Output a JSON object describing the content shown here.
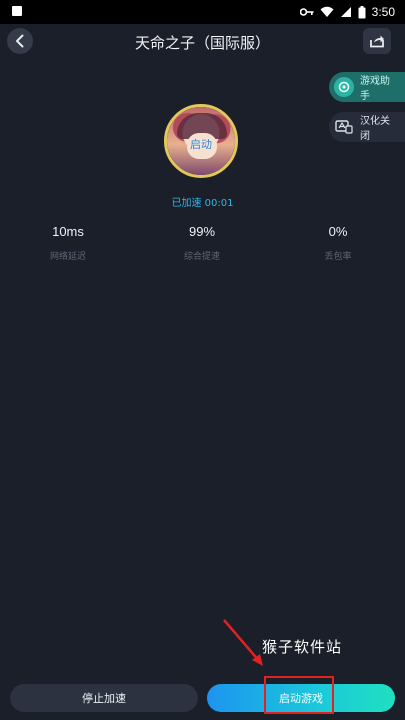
{
  "status_bar": {
    "time": "3:50",
    "icons": [
      "key-icon",
      "wifi-icon",
      "signal-icon",
      "battery-icon"
    ]
  },
  "header": {
    "title": "天命之子（国际服）",
    "back_icon": "chevron-left-icon",
    "share_icon": "share-icon"
  },
  "side_pills": {
    "assistant_label": "游戏助手",
    "chinese_label": "汉化关闭"
  },
  "avatar": {
    "overlay_text": "启动"
  },
  "accel": {
    "status": "已加速 00:01"
  },
  "stats": [
    {
      "value": "10ms",
      "label": "网络延迟"
    },
    {
      "value": "99%",
      "label": "综合提速"
    },
    {
      "value": "0%",
      "label": "丢包率"
    }
  ],
  "watermark": {
    "text": "猴子软件站"
  },
  "buttons": {
    "stop_label": "停止加速",
    "launch_label": "启动游戏"
  },
  "colors": {
    "background": "#1b1f29",
    "accent_cyan": "#2fb6e6",
    "highlight_red": "#e02222"
  }
}
